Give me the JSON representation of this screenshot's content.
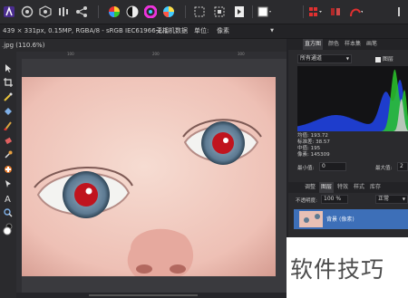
{
  "toolbar": {
    "icons": [
      "app-persona-icon",
      "develop-persona-icon",
      "liquify-persona-icon",
      "tone-map-persona-icon",
      "share-icon",
      "color-wheel-icon",
      "contrast-icon",
      "saturation-icon",
      "white-balance-icon",
      "marquee-select-icon",
      "lasso-icon",
      "mask-icon",
      "fill-icon",
      "snapping-icon",
      "flow-icon",
      "assistant-icon"
    ]
  },
  "context": {
    "doc_info": "439 × 331px, 0.15MP, RGBA/8 - sRGB IEC61966-2.1",
    "metadata_label": "无相机数据",
    "units_label": "单位:",
    "units_value": "像素"
  },
  "document": {
    "tab_title": ".jpg (110.6%)"
  },
  "ruler": {
    "ticks": [
      "100",
      "200",
      "300"
    ]
  },
  "histogram_panel": {
    "tabs": [
      "直方图",
      "颜色",
      "样本集",
      "画笔"
    ],
    "active_tab": "直方图",
    "channel_select": "所有通道",
    "layer_label": "图层",
    "stats_labels": [
      "均值:",
      "标准差:",
      "中值:",
      "像素:"
    ],
    "stats_values": [
      "193.72",
      "38.57",
      "195",
      "145309"
    ],
    "min_label": "最小值:",
    "min_value": "0",
    "max_label": "最大值:",
    "max_value": "2"
  },
  "layers_panel": {
    "tabs": [
      "调整",
      "图层",
      "特效",
      "样式",
      "库存"
    ],
    "active_tab": "图层",
    "opacity_label": "不透明度:",
    "opacity_value": "100 %",
    "blend_mode": "正常",
    "layer_name": "背景",
    "layer_kind": "(像素)"
  },
  "watermark": {
    "text": "软件技巧"
  },
  "colors": {
    "accent": "#3d6fb8",
    "histogram_blue": "#1f3fd6",
    "histogram_green": "#2bc82b",
    "red_eye": "#c0141e"
  }
}
